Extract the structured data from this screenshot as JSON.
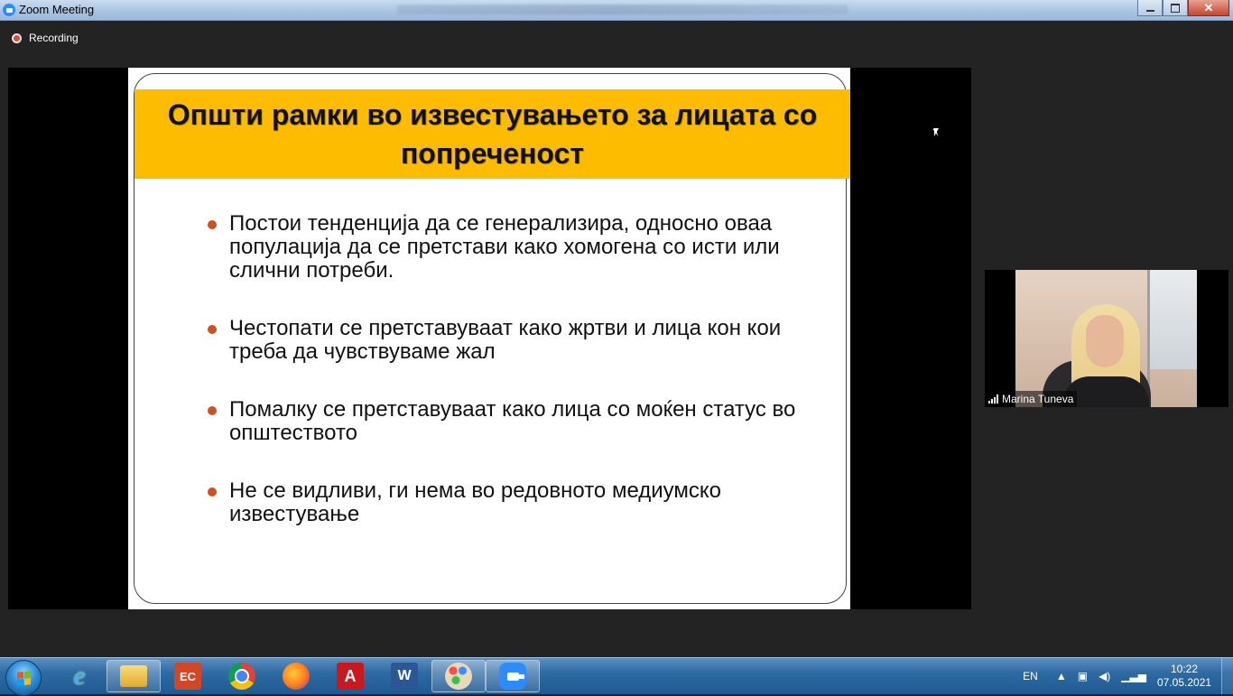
{
  "window": {
    "title": "Zoom Meeting",
    "close_symbol": "✕"
  },
  "recording": {
    "label": "Recording"
  },
  "slide": {
    "title": "Општи рамки во известувањето за лицата со попреченост",
    "bullets": [
      "Постои тенденција да се генерализира, односно оваа популација да се претстави како хомогена со исти или слични потреби.",
      "Честопати се претставуваат како жртви и лица кон кои треба да чувствуваме жал",
      "Помалку се претставуваат како лица со моќен статус во општеството",
      "Не се видливи, ги нема во редовното медиумско известување"
    ],
    "title_bg_color": "#fdbc00",
    "bullet_color": "#d24f1e"
  },
  "participant": {
    "name": "Marina Tuneva"
  },
  "taskbar": {
    "apps": [
      {
        "icon": "internet-explorer-icon",
        "glyph": "e"
      },
      {
        "icon": "file-explorer-icon",
        "glyph": ""
      },
      {
        "icon": "presentation-icon",
        "glyph": "EC"
      },
      {
        "icon": "chrome-icon",
        "glyph": ""
      },
      {
        "icon": "firefox-icon",
        "glyph": ""
      },
      {
        "icon": "acrobat-pdf-icon",
        "glyph": "A"
      },
      {
        "icon": "word-icon",
        "glyph": "W"
      },
      {
        "icon": "paint-icon",
        "glyph": ""
      },
      {
        "icon": "zoom-icon",
        "glyph": ""
      }
    ],
    "language": "EN",
    "time": "10:22",
    "date": "07.05.2021"
  }
}
